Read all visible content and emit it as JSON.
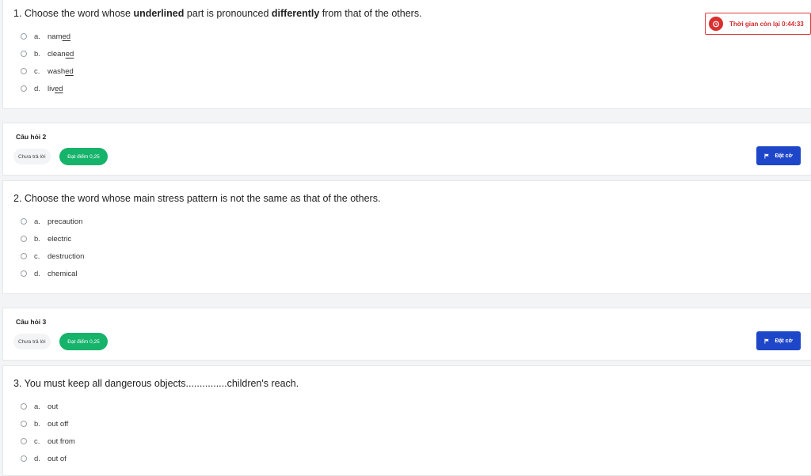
{
  "timer": {
    "text": "Thời gian còn lại 0:44:33"
  },
  "q1": {
    "text_prefix": "1. Choose the word whose ",
    "text_bold1": "underlined",
    "text_mid": " part is pronounced ",
    "text_bold2": "differently",
    "text_suffix": " from that of the others.",
    "options": [
      {
        "letter": "a.",
        "stem": "nam",
        "underlined": "ed"
      },
      {
        "letter": "b.",
        "stem": "clean",
        "underlined": "ed"
      },
      {
        "letter": "c.",
        "stem": "wash",
        "underlined": "ed"
      },
      {
        "letter": "d.",
        "stem": "liv",
        "underlined": "ed"
      }
    ]
  },
  "info2": {
    "title": "Câu hỏi 2",
    "status": "Chưa trả lời",
    "score": "Đạt điểm 0,25",
    "flag_label": "Đặt cờ"
  },
  "q2": {
    "text": "2. Choose the word whose main stress pattern is not the same as that of the others.",
    "options": [
      {
        "letter": "a.",
        "label": "precaution"
      },
      {
        "letter": "b.",
        "label": "electric"
      },
      {
        "letter": "c.",
        "label": "destruction"
      },
      {
        "letter": "d.",
        "label": "chemical"
      }
    ]
  },
  "info3": {
    "title": "Câu hỏi 3",
    "status": "Chưa trả lời",
    "score": "Đạt điểm 0,25",
    "flag_label": "Đặt cờ"
  },
  "q3": {
    "text": "3. You must keep all dangerous objects...............children's reach.",
    "options": [
      {
        "letter": "a.",
        "label": "out"
      },
      {
        "letter": "b.",
        "label": "out off"
      },
      {
        "letter": "c.",
        "label": "out from"
      },
      {
        "letter": "d.",
        "label": "out of"
      }
    ]
  },
  "colors": {
    "accent_blue": "#1e46c8",
    "success_green": "#16b36b",
    "timer_red": "#d92f2f"
  },
  "icons": {
    "timer": "alarm-icon",
    "flag": "flag-icon"
  }
}
